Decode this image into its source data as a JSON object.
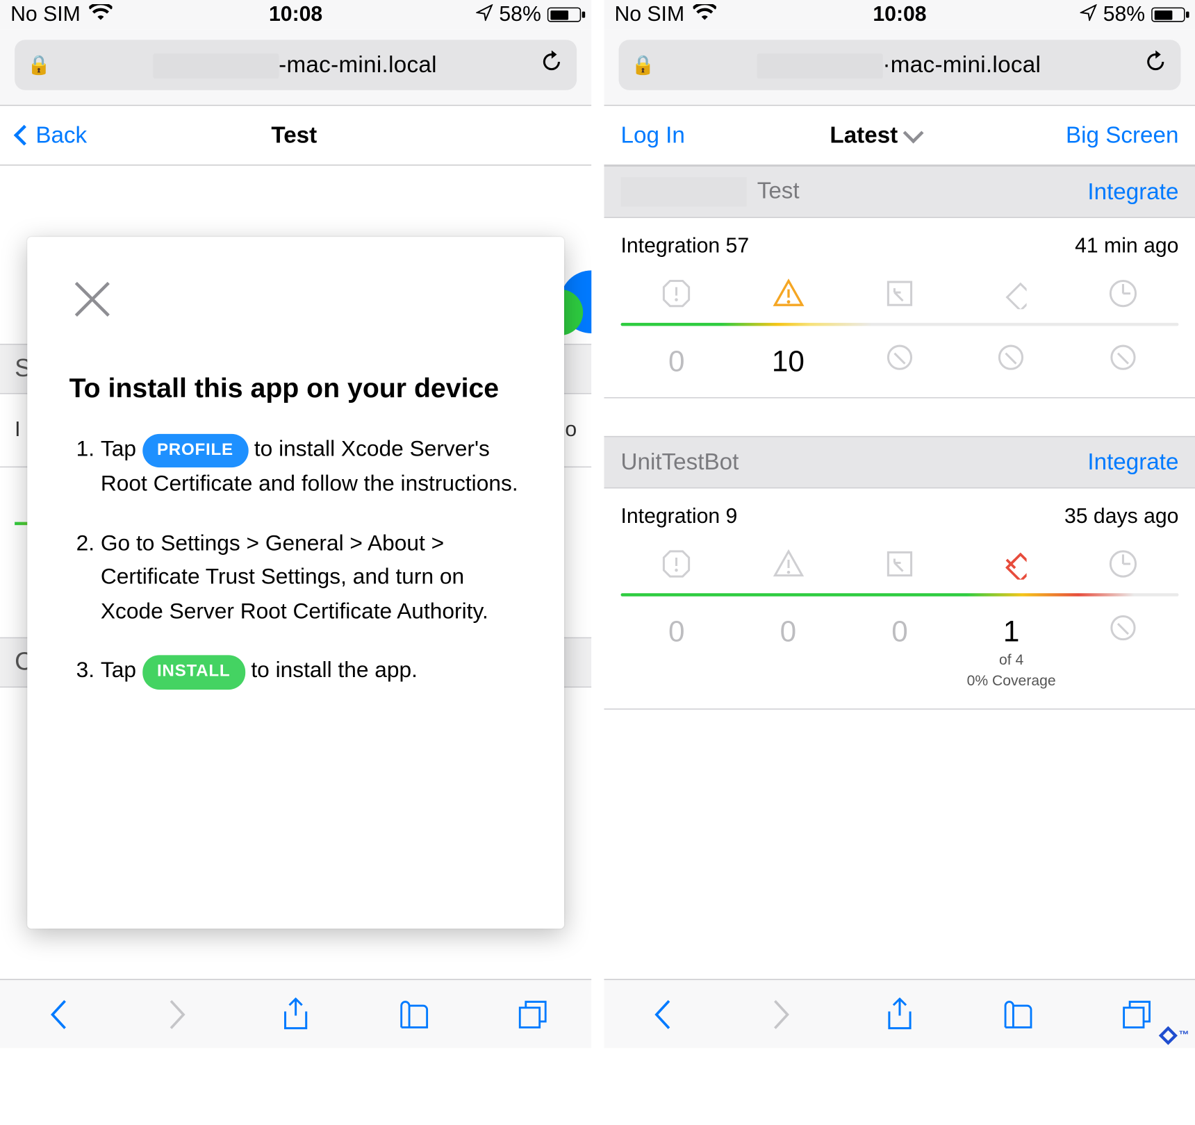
{
  "status": {
    "carrier": "No SIM",
    "time": "10:08",
    "battery_pct": "58%"
  },
  "urlbar": {
    "host_left": "-mac-mini.local",
    "host_right": "·mac-mini.local"
  },
  "left_screen": {
    "nav": {
      "back": "Back",
      "title": "Test"
    },
    "modal": {
      "heading": "To install this app on your device",
      "step1_a": "Tap",
      "step1_pill": "PROFILE",
      "step1_b": "to install Xcode Server's Root Certificate and follow the instructions.",
      "step2": "Go to Settings > General > About > Certificate Trust Settings, and turn on Xcode Server Root Certificate Authority.",
      "step3_a": "Tap",
      "step3_pill": "INSTALL",
      "step3_b": "to install the app."
    },
    "dim": {
      "row1": "S",
      "row2_left": "I",
      "row2_right": "o",
      "row3": "C"
    }
  },
  "right_screen": {
    "nav": {
      "login": "Log In",
      "title": "Latest",
      "bigscreen": "Big Screen"
    },
    "bots": [
      {
        "header_name": "Test",
        "action": "Integrate",
        "int_label": "Integration 57",
        "time": "41 min ago",
        "icons_active": "warning",
        "values": {
          "errors": "0",
          "warnings": "10",
          "analysis": "–",
          "tests": "–",
          "perf": "–"
        }
      },
      {
        "header_name": "UnitTestBot",
        "action": "Integrate",
        "int_label": "Integration 9",
        "time": "35 days ago",
        "icons_active": "testfail",
        "values": {
          "errors": "0",
          "warnings": "0",
          "analysis": "0",
          "tests": "1",
          "tests_sub1": "of 4",
          "tests_sub2": "0% Coverage",
          "perf": "–"
        }
      }
    ]
  }
}
